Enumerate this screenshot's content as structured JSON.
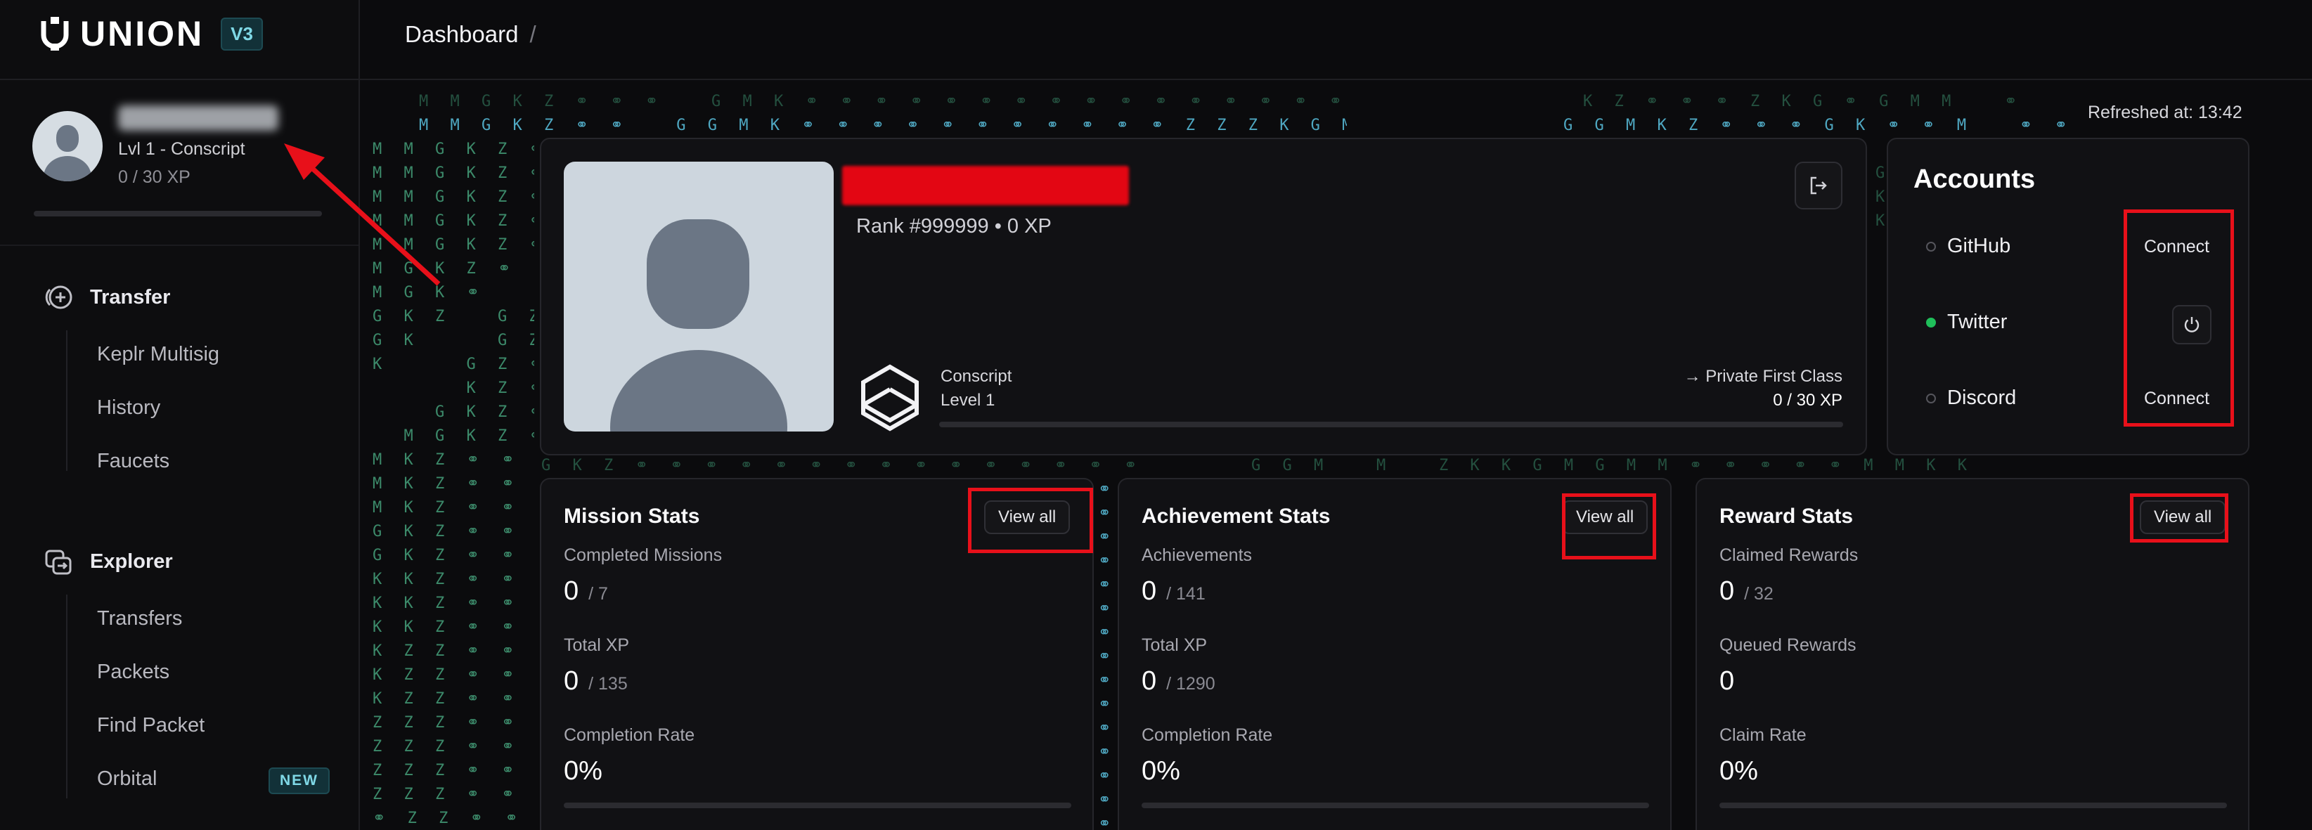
{
  "app": {
    "logo_text": "UNION",
    "version_badge": "V3"
  },
  "profile": {
    "level_text": "Lvl 1 - Conscript",
    "xp_text": "0 / 30 XP",
    "xp_progress": 0
  },
  "sidebar": {
    "sections": [
      {
        "label": "Transfer",
        "icon": "transfer-icon",
        "items": [
          "Keplr Multisig",
          "History",
          "Faucets"
        ]
      },
      {
        "label": "Explorer",
        "icon": "explorer-icon",
        "items": [
          "Transfers",
          "Packets",
          "Find Packet",
          "Orbital"
        ]
      }
    ],
    "new_badge": "NEW"
  },
  "header": {
    "breadcrumb": "Dashboard",
    "separator": "/"
  },
  "refreshed_text": "Refreshed at: 13:42",
  "matrix": {
    "row_a": "M M G K Z ⚭ ⚭ ⚭   G M K ⚭ ⚭ ⚭ ⚭ ⚭ ⚭ ⚭ ⚭ ⚭ ⚭ ⚭ ⚭ ⚭ ⚭ ⚭ ⚭ ⚭ Z Z K G M M",
    "row_b": "M M G K Z ⚭ ⚭   G G M K ⚭ ⚭ ⚭ ⚭ ⚭ ⚭ ⚭ ⚭ ⚭ ⚭ ⚭ Z Z Z K G M M",
    "row_c": "K Z ⚭ ⚭ ⚭ Z K G ⚭ G M M   ⚭ ⚭ M G K Z",
    "row_d": "G G M K Z ⚭ ⚭ ⚭ G K ⚭ ⚭ M   ⚭ ⚭ M M ⚭ ⚭ ⚭ ⚭",
    "left_col": "M M G K Z ⚭\nM M G K Z ⚭\nM M G K Z ⚭\nM M G K Z ⚭\nM M G K Z ⚭\nM G K Z ⚭\nM G K ⚭\nG K Z   G Z\nG K     G Z\nK     G Z ⚭\n      K Z ⚭\n    G K Z ⚭\n  M G K Z ⚭\nM K Z ⚭ ⚭ ⚭\nM K Z ⚭ ⚭ ⚭\nM K Z ⚭ ⚭ ⚭\nG K Z ⚭ ⚭ ⚭ ⚭ ⚭ ⚭\nG K Z ⚭ ⚭ ⚭ ⚭ ⚭ ⚭\nK K Z ⚭ ⚭ ⚭ ⚭ ⚭ ⚭\nK K Z ⚭ ⚭ ⚭ ⚭ ⚭ ⚭\nK K Z ⚭ ⚭ ⚭ ⚭ ⚭ ⚭\nK Z Z ⚭ ⚭ ⚭ ⚭ ⚭ ⚭\nK Z Z ⚭ ⚭ ⚭ ⚭ ⚭ ⚭\nK Z Z ⚭ ⚭ ⚭ ⚭ ⚭ ⚭\nZ Z Z ⚭ ⚭ ⚭ ⚭ ⚭ ⚭\nZ Z Z ⚭ ⚭ ⚭ ⚭ ⚭ ⚭\nZ Z Z ⚭ ⚭ ⚭ ⚭ ⚭ ⚭\nZ Z Z ⚭ ⚭ ⚭ ⚭ ⚭ ⚭\n⚭ Z Z ⚭ ⚭ ⚭ ⚭ ⚭ ⚭\n⚭ ⚭ Z ⚭ ⚭ ⚭ ⚭ ⚭ ⚭",
    "mid_row": "G K Z ⚭ ⚭ ⚭ ⚭ ⚭ ⚭ ⚭ ⚭ ⚭ ⚭ ⚭ ⚭ ⚭ ⚭ ⚭ ⚭ ⚭ ⚭ Z Z Z K G",
    "mid_row_right": "G G M   M   Z K K G M G M M ⚭ ⚭ ⚭ ⚭ ⚭ M M K K",
    "sep_col": "⚭\n⚭\n⚭\n⚭\n⚭\n⚭\n⚭\n⚭\n⚭\n⚭\n⚭\n⚭\n⚭\n⚭\n⚭\n⚭\n⚭",
    "right_col": "G\nK\nK"
  },
  "player": {
    "rank_text": "Rank #999999 • 0 XP",
    "rank_title": "Conscript",
    "level": "Level 1",
    "next_rank": "→ Private First Class",
    "xp": "0 / 30 XP",
    "xp_progress": 0
  },
  "accounts": {
    "title": "Accounts",
    "items": [
      {
        "name": "GitHub",
        "status": "disconnected",
        "action": "Connect"
      },
      {
        "name": "Twitter",
        "status": "connected",
        "action_icon": "power-icon"
      },
      {
        "name": "Discord",
        "status": "disconnected",
        "action": "Connect"
      }
    ]
  },
  "stats": [
    {
      "title": "Mission Stats",
      "view_all": "View all",
      "rows": [
        {
          "label": "Completed Missions",
          "value": "0",
          "of": "/ 7"
        },
        {
          "label": "Total XP",
          "value": "0",
          "of": "/ 135"
        },
        {
          "label": "Completion Rate",
          "value": "0%",
          "of": ""
        }
      ]
    },
    {
      "title": "Achievement Stats",
      "view_all": "View all",
      "rows": [
        {
          "label": "Achievements",
          "value": "0",
          "of": "/ 141"
        },
        {
          "label": "Total XP",
          "value": "0",
          "of": "/ 1290"
        },
        {
          "label": "Completion Rate",
          "value": "0%",
          "of": ""
        }
      ]
    },
    {
      "title": "Reward Stats",
      "view_all": "View all",
      "rows": [
        {
          "label": "Claimed Rewards",
          "value": "0",
          "of": "/ 32"
        },
        {
          "label": "Queued Rewards",
          "value": "0",
          "of": ""
        },
        {
          "label": "Claim Rate",
          "value": "0%",
          "of": ""
        }
      ]
    }
  ],
  "colors": {
    "background": "#0b0b0d",
    "card": "#111114",
    "accent_cyan": "#7fd8e6",
    "annotation_red": "#e8101a",
    "connected_green": "#1fbf5a"
  }
}
